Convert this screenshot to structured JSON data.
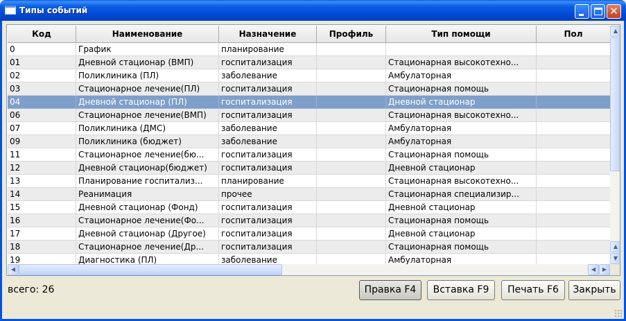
{
  "window": {
    "title": "Типы событий"
  },
  "table": {
    "columns": [
      "Код",
      "Наименование",
      "Назначение",
      "Профиль",
      "Тип помощи",
      "Пол"
    ],
    "rows": [
      [
        "0",
        "График",
        "планирование",
        "",
        "",
        ""
      ],
      [
        "01",
        "Дневной стационар (ВМП)",
        "госпитализация",
        "",
        "Стационарная высокотехно...",
        ""
      ],
      [
        "02",
        "Поликлиника (ПЛ)",
        "заболевание",
        "",
        "Амбулаторная",
        ""
      ],
      [
        "03",
        "Стационарное лечение(ПЛ)",
        "госпитализация",
        "",
        "Стационарная помощь",
        ""
      ],
      [
        "04",
        "Дневной стационар (ПЛ)",
        "госпитализация",
        "",
        "Дневной стационар",
        ""
      ],
      [
        "06",
        "Стационарное лечение(ВМП)",
        "госпитализация",
        "",
        "Стационарная высокотехно...",
        ""
      ],
      [
        "07",
        "Поликлиника (ДМС)",
        "заболевание",
        "",
        "Амбулаторная",
        ""
      ],
      [
        "09",
        "Поликлиника (бюджет)",
        "заболевание",
        "",
        "Амбулаторная",
        ""
      ],
      [
        "11",
        "Стационарное лечение(бю...",
        "госпитализация",
        "",
        "Стационарная помощь",
        ""
      ],
      [
        "12",
        "Дневной стационар(бюджет)",
        "госпитализация",
        "",
        "Дневной стационар",
        ""
      ],
      [
        "13",
        "Планирование госпитализ...",
        "планирование",
        "",
        "Стационарная высокотехно...",
        ""
      ],
      [
        "14",
        "Реанимация",
        "прочее",
        "",
        "Стационарная специализир...",
        ""
      ],
      [
        "15",
        "Дневной стационар (Фонд)",
        "госпитализация",
        "",
        "Дневной стационар",
        ""
      ],
      [
        "16",
        "Стационарное лечение(Фо...",
        "госпитализация",
        "",
        "Стационарная помощь",
        ""
      ],
      [
        "17",
        "Дневной стационар (Другое)",
        "госпитализация",
        "",
        "Дневной стационар",
        ""
      ],
      [
        "18",
        "Стационарное лечение(Др...",
        "госпитализация",
        "",
        "Стационарная помощь",
        ""
      ],
      [
        "19",
        "Диагностика (ПЛ)",
        "заболевание",
        "",
        "Амбулаторная",
        ""
      ]
    ],
    "selected_row": 4
  },
  "footer": {
    "total": "всего: 26",
    "buttons": [
      "Правка F4",
      "Вставка F9",
      "Печать F6",
      "Закрыть"
    ]
  },
  "colors": {
    "titlebar": "#0a5fe6",
    "selection": "#7e9fc9",
    "alt_row": "#ececec"
  }
}
